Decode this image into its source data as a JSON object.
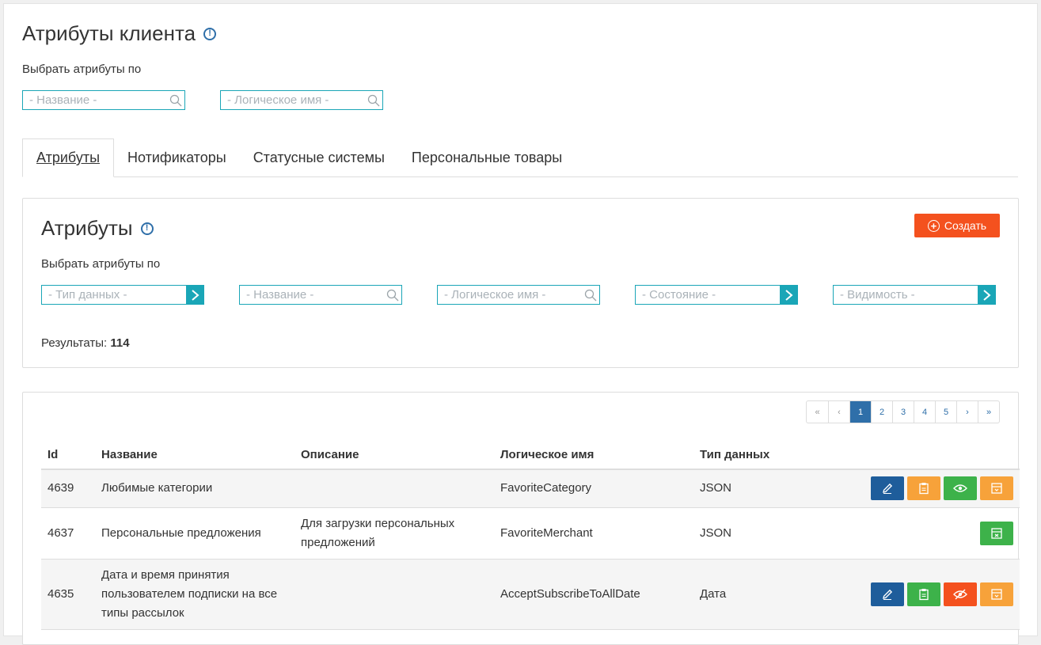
{
  "header": {
    "title": "Атрибуты клиента",
    "select_label": "Выбрать атрибуты по",
    "filters": {
      "name_placeholder": "- Название -",
      "logical_placeholder": "- Логическое имя -"
    }
  },
  "tabs": [
    {
      "label": "Атрибуты",
      "active": true
    },
    {
      "label": "Нотификаторы",
      "active": false
    },
    {
      "label": "Статусные системы",
      "active": false
    },
    {
      "label": "Персональные товары",
      "active": false
    }
  ],
  "attributes_panel": {
    "title": "Атрибуты",
    "create_label": "Создать",
    "select_label": "Выбрать атрибуты по",
    "filters": {
      "datatype_placeholder": "- Тип данных -",
      "name_placeholder": "- Название -",
      "logical_placeholder": "- Логическое имя -",
      "state_placeholder": "- Состояние -",
      "visibility_placeholder": "- Видимость -"
    },
    "results_label": "Результаты:",
    "results_count": "114"
  },
  "pagination": {
    "first": "«",
    "prev": "‹",
    "pages": [
      "1",
      "2",
      "3",
      "4",
      "5"
    ],
    "next": "›",
    "last": "»",
    "current": "1"
  },
  "table": {
    "columns": [
      "Id",
      "Название",
      "Описание",
      "Логическое имя",
      "Тип данных"
    ],
    "rows": [
      {
        "id": "4639",
        "name": "Любимые категории",
        "description": "",
        "logical": "FavoriteCategory",
        "type": "JSON"
      },
      {
        "id": "4637",
        "name": "Персональные предложения",
        "description": "Для загрузки персональных предложений",
        "logical": "FavoriteMerchant",
        "type": "JSON"
      },
      {
        "id": "4635",
        "name": "Дата и время принятия пользователем подписки на все типы рассылок",
        "description": "",
        "logical": "AcceptSubscribeToAllDate",
        "type": "Дата"
      }
    ]
  },
  "colors": {
    "accent_teal": "#1aa6b7",
    "primary_blue": "#1e5d9b",
    "orange": "#f7a23a",
    "green": "#3db24a",
    "red": "#f4511e"
  }
}
